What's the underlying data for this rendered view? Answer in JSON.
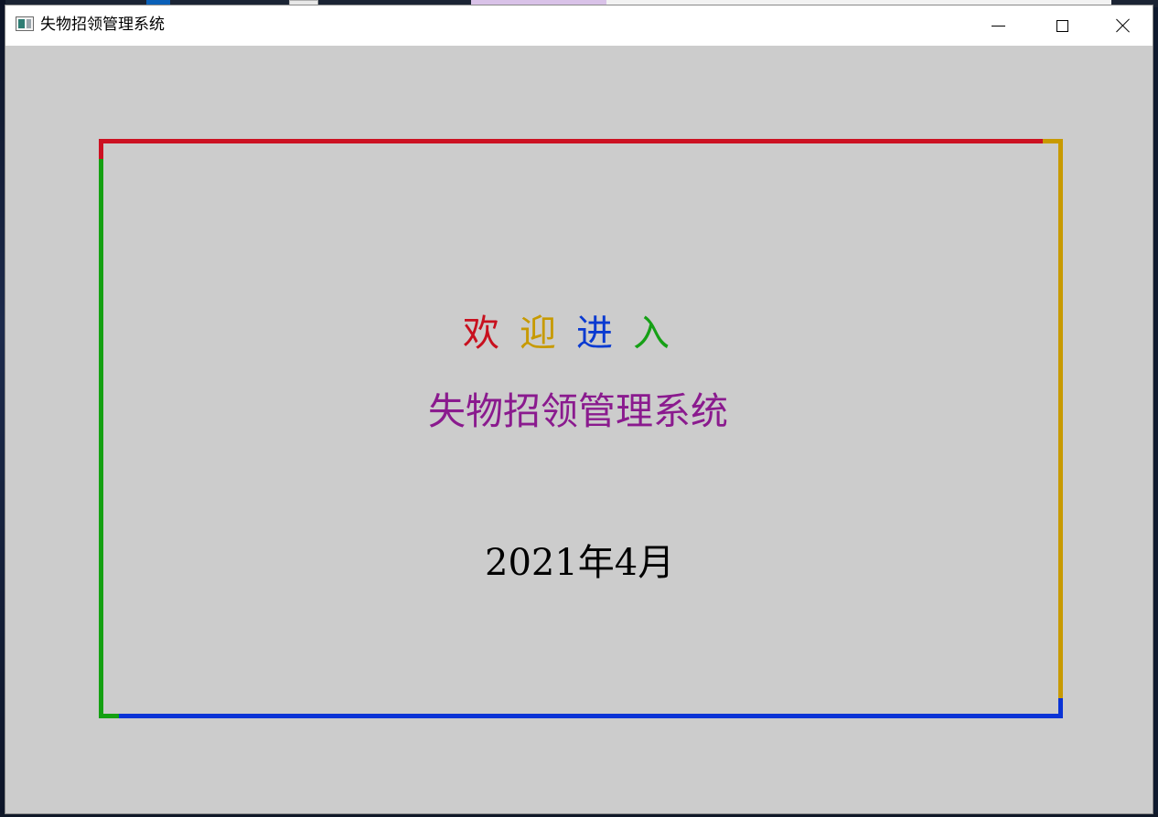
{
  "window": {
    "title": "失物招领管理系统"
  },
  "welcome": {
    "chars": [
      "欢",
      "迎",
      "进",
      "入"
    ],
    "colors": [
      "#c8101e",
      "#c79a00",
      "#0a3ad1",
      "#16a016"
    ]
  },
  "system_name": {
    "text": "失物招领管理系统",
    "color": "#8a1a8e"
  },
  "date": {
    "text": "2021年4月"
  },
  "frame": {
    "top_color": "#cc1122",
    "right_color": "#c89a00",
    "bottom_color": "#0a33d6",
    "left_color": "#14a012"
  },
  "icons": {
    "app": "app-window-icon",
    "minimize": "minimize-icon",
    "maximize": "maximize-icon",
    "close": "close-icon"
  }
}
